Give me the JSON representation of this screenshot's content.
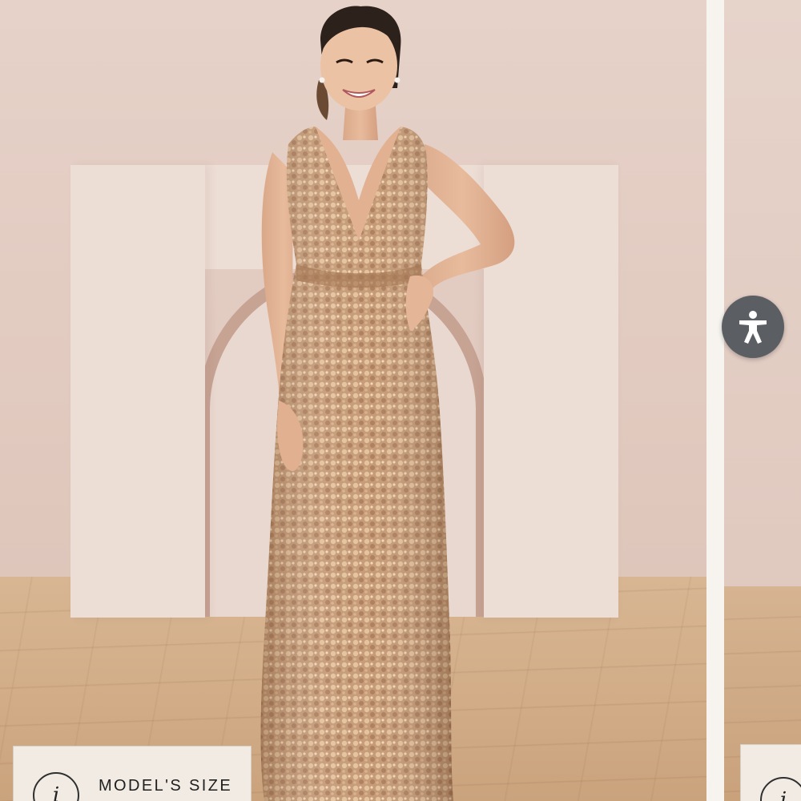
{
  "gallery": {
    "main_image": {
      "alt": "",
      "backdrop_wall_color": "#e3ccc3",
      "floor_color": "#d2ad88",
      "dress_color": "#c4946e"
    },
    "next_image": {
      "alt": ""
    }
  },
  "accessibility": {
    "icon": "accessibility-person-icon",
    "color": "#5b5f63"
  },
  "model_size_tag": {
    "icon_glyph": "i",
    "icon": "info-icon",
    "label": "MODEL'S SIZE"
  },
  "next_model_size_tag": {
    "icon_glyph": "i",
    "icon": "info-icon"
  }
}
